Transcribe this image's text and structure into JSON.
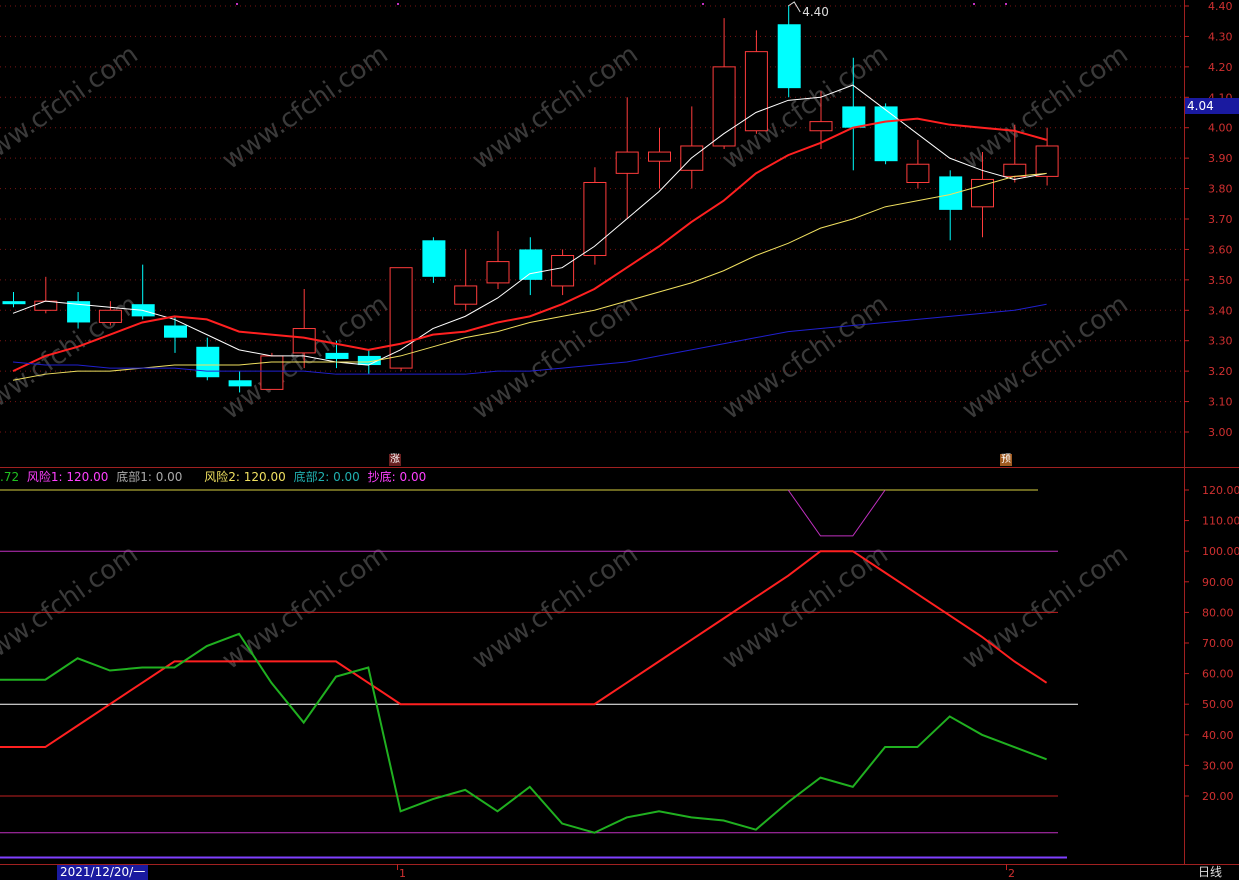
{
  "chart_data": [
    {
      "type": "candlestick",
      "panel": "main",
      "y_ticks": [
        "4.40",
        "4.30",
        "4.20",
        "4.10",
        "4.00",
        "3.90",
        "3.80",
        "3.70",
        "3.60",
        "3.50",
        "3.40",
        "3.30",
        "3.20",
        "3.10",
        "3.00"
      ],
      "ylim": [
        2.92,
        4.42
      ],
      "current_price": "4.04",
      "high_label": "4.40",
      "candles": [
        {
          "o": 3.43,
          "h": 3.46,
          "l": 3.41,
          "c": 3.42
        },
        {
          "o": 3.4,
          "h": 3.51,
          "l": 3.39,
          "c": 3.43
        },
        {
          "o": 3.43,
          "h": 3.46,
          "l": 3.34,
          "c": 3.36
        },
        {
          "o": 3.36,
          "h": 3.43,
          "l": 3.35,
          "c": 3.4
        },
        {
          "o": 3.42,
          "h": 3.55,
          "l": 3.37,
          "c": 3.38
        },
        {
          "o": 3.35,
          "h": 3.38,
          "l": 3.26,
          "c": 3.31
        },
        {
          "o": 3.28,
          "h": 3.31,
          "l": 3.17,
          "c": 3.18
        },
        {
          "o": 3.17,
          "h": 3.2,
          "l": 3.13,
          "c": 3.15
        },
        {
          "o": 3.14,
          "h": 3.26,
          "l": 3.14,
          "c": 3.25
        },
        {
          "o": 3.26,
          "h": 3.47,
          "l": 3.21,
          "c": 3.34
        },
        {
          "o": 3.26,
          "h": 3.3,
          "l": 3.21,
          "c": 3.24
        },
        {
          "o": 3.25,
          "h": 3.27,
          "l": 3.19,
          "c": 3.22
        },
        {
          "o": 3.21,
          "h": 3.54,
          "l": 3.2,
          "c": 3.54
        },
        {
          "o": 3.63,
          "h": 3.64,
          "l": 3.49,
          "c": 3.51
        },
        {
          "o": 3.42,
          "h": 3.6,
          "l": 3.4,
          "c": 3.48
        },
        {
          "o": 3.49,
          "h": 3.66,
          "l": 3.47,
          "c": 3.56
        },
        {
          "o": 3.6,
          "h": 3.64,
          "l": 3.45,
          "c": 3.5
        },
        {
          "o": 3.48,
          "h": 3.6,
          "l": 3.45,
          "c": 3.58
        },
        {
          "o": 3.58,
          "h": 3.87,
          "l": 3.55,
          "c": 3.82
        },
        {
          "o": 3.85,
          "h": 4.1,
          "l": 3.7,
          "c": 3.92
        },
        {
          "o": 3.89,
          "h": 4.0,
          "l": 3.8,
          "c": 3.92
        },
        {
          "o": 3.86,
          "h": 4.07,
          "l": 3.8,
          "c": 3.94
        },
        {
          "o": 3.94,
          "h": 4.36,
          "l": 3.93,
          "c": 4.2
        },
        {
          "o": 3.99,
          "h": 4.32,
          "l": 3.98,
          "c": 4.25
        },
        {
          "o": 4.34,
          "h": 4.4,
          "l": 4.1,
          "c": 4.13
        },
        {
          "o": 3.99,
          "h": 4.12,
          "l": 3.93,
          "c": 4.02
        },
        {
          "o": 4.07,
          "h": 4.23,
          "l": 3.86,
          "c": 4.0
        },
        {
          "o": 4.07,
          "h": 4.08,
          "l": 3.88,
          "c": 3.89
        },
        {
          "o": 3.82,
          "h": 3.96,
          "l": 3.8,
          "c": 3.88
        },
        {
          "o": 3.84,
          "h": 3.86,
          "l": 3.63,
          "c": 3.73
        },
        {
          "o": 3.74,
          "h": 3.92,
          "l": 3.64,
          "c": 3.83
        },
        {
          "o": 3.84,
          "h": 4.01,
          "l": 3.82,
          "c": 3.88
        },
        {
          "o": 3.84,
          "h": 4.0,
          "l": 3.81,
          "c": 3.94
        }
      ],
      "moving_averages": [
        {
          "color": "#ffffff",
          "values": [
            3.39,
            3.43,
            3.42,
            3.41,
            3.4,
            3.37,
            3.32,
            3.27,
            3.25,
            3.25,
            3.23,
            3.22,
            3.27,
            3.34,
            3.38,
            3.44,
            3.52,
            3.54,
            3.61,
            3.7,
            3.79,
            3.9,
            3.98,
            4.05,
            4.09,
            4.1,
            4.14,
            4.06,
            3.98,
            3.9,
            3.86,
            3.83,
            3.85
          ]
        },
        {
          "color": "#ff2020",
          "values": [
            3.2,
            3.25,
            3.28,
            3.32,
            3.36,
            3.38,
            3.37,
            3.33,
            3.32,
            3.31,
            3.29,
            3.27,
            3.29,
            3.32,
            3.33,
            3.36,
            3.38,
            3.42,
            3.47,
            3.54,
            3.61,
            3.69,
            3.76,
            3.85,
            3.91,
            3.95,
            4.0,
            4.02,
            4.03,
            4.01,
            4.0,
            3.99,
            3.96
          ]
        },
        {
          "color": "#f0e060",
          "values": [
            3.17,
            3.19,
            3.2,
            3.2,
            3.21,
            3.22,
            3.22,
            3.22,
            3.23,
            3.23,
            3.23,
            3.23,
            3.25,
            3.28,
            3.31,
            3.33,
            3.36,
            3.38,
            3.4,
            3.43,
            3.46,
            3.49,
            3.53,
            3.58,
            3.62,
            3.67,
            3.7,
            3.74,
            3.76,
            3.78,
            3.81,
            3.84,
            3.85
          ]
        },
        {
          "color": "#2020d0",
          "values": [
            3.23,
            3.22,
            3.22,
            3.21,
            3.21,
            3.21,
            3.2,
            3.2,
            3.2,
            3.2,
            3.19,
            3.19,
            3.19,
            3.19,
            3.19,
            3.2,
            3.2,
            3.21,
            3.22,
            3.23,
            3.25,
            3.27,
            3.29,
            3.31,
            3.33,
            3.34,
            3.35,
            3.36,
            3.37,
            3.38,
            3.39,
            3.4,
            3.42
          ]
        }
      ],
      "markers": [
        {
          "index": 12,
          "label": "涨"
        },
        {
          "index": 31,
          "label": "预"
        }
      ]
    },
    {
      "type": "line",
      "panel": "indicator",
      "legend": [
        {
          "text": ".72",
          "color": "#20c020"
        },
        {
          "text": "风险1: 120.00",
          "color": "#ff40ff"
        },
        {
          "text": "底部1: 0.00",
          "color": "#aaaaaa"
        },
        {
          "text": "风险2: 120.00",
          "color": "#f0e060"
        },
        {
          "text": "底部2: 0.00",
          "color": "#20b0b0"
        },
        {
          "text": "抄底: 0.00",
          "color": "#ff40ff"
        }
      ],
      "y_ticks": [
        "120.00",
        "110.00",
        "100.00",
        "90.00",
        "80.00",
        "70.00",
        "60.00",
        "50.00",
        "40.00",
        "30.00",
        "20.00"
      ],
      "ylim": [
        4,
        126
      ],
      "reference_lines": [
        {
          "value": 120,
          "color": "#d8d040"
        },
        {
          "value": 100,
          "color": "#c030c0"
        },
        {
          "value": 80,
          "color": "#c02020"
        },
        {
          "value": 50,
          "color": "#ffffff"
        },
        {
          "value": 20,
          "color": "#c02020"
        },
        {
          "value": 8,
          "color": "#c030c0"
        }
      ],
      "series": [
        {
          "color": "#ff2020",
          "values": [
            36,
            36,
            43,
            50,
            57,
            64,
            64,
            64,
            64,
            64,
            64,
            57,
            50,
            50,
            50,
            50,
            50,
            50,
            50,
            57,
            64,
            71,
            78,
            85,
            92,
            100,
            100,
            93,
            86,
            79,
            72,
            64,
            57
          ]
        },
        {
          "color": "#20b020",
          "values": [
            58,
            58,
            65,
            61,
            62,
            62,
            69,
            73,
            57,
            44,
            59,
            62,
            15,
            19,
            22,
            15,
            23,
            11,
            8,
            13,
            15,
            13,
            12,
            9,
            18,
            26,
            23,
            36,
            36,
            46,
            40,
            36,
            32
          ]
        },
        {
          "color": "#c030c0",
          "values": [
            null,
            null,
            null,
            null,
            null,
            null,
            null,
            null,
            null,
            null,
            null,
            null,
            null,
            null,
            null,
            null,
            null,
            null,
            null,
            null,
            null,
            null,
            null,
            null,
            120,
            105,
            105,
            120,
            null,
            null,
            null,
            null,
            null
          ]
        }
      ]
    }
  ],
  "labels": {
    "bottom_date": "2021/12/20/一",
    "x_tick_1": "1",
    "x_tick_2": "2",
    "period": "日线",
    "watermark": "www.cfchi.com"
  }
}
